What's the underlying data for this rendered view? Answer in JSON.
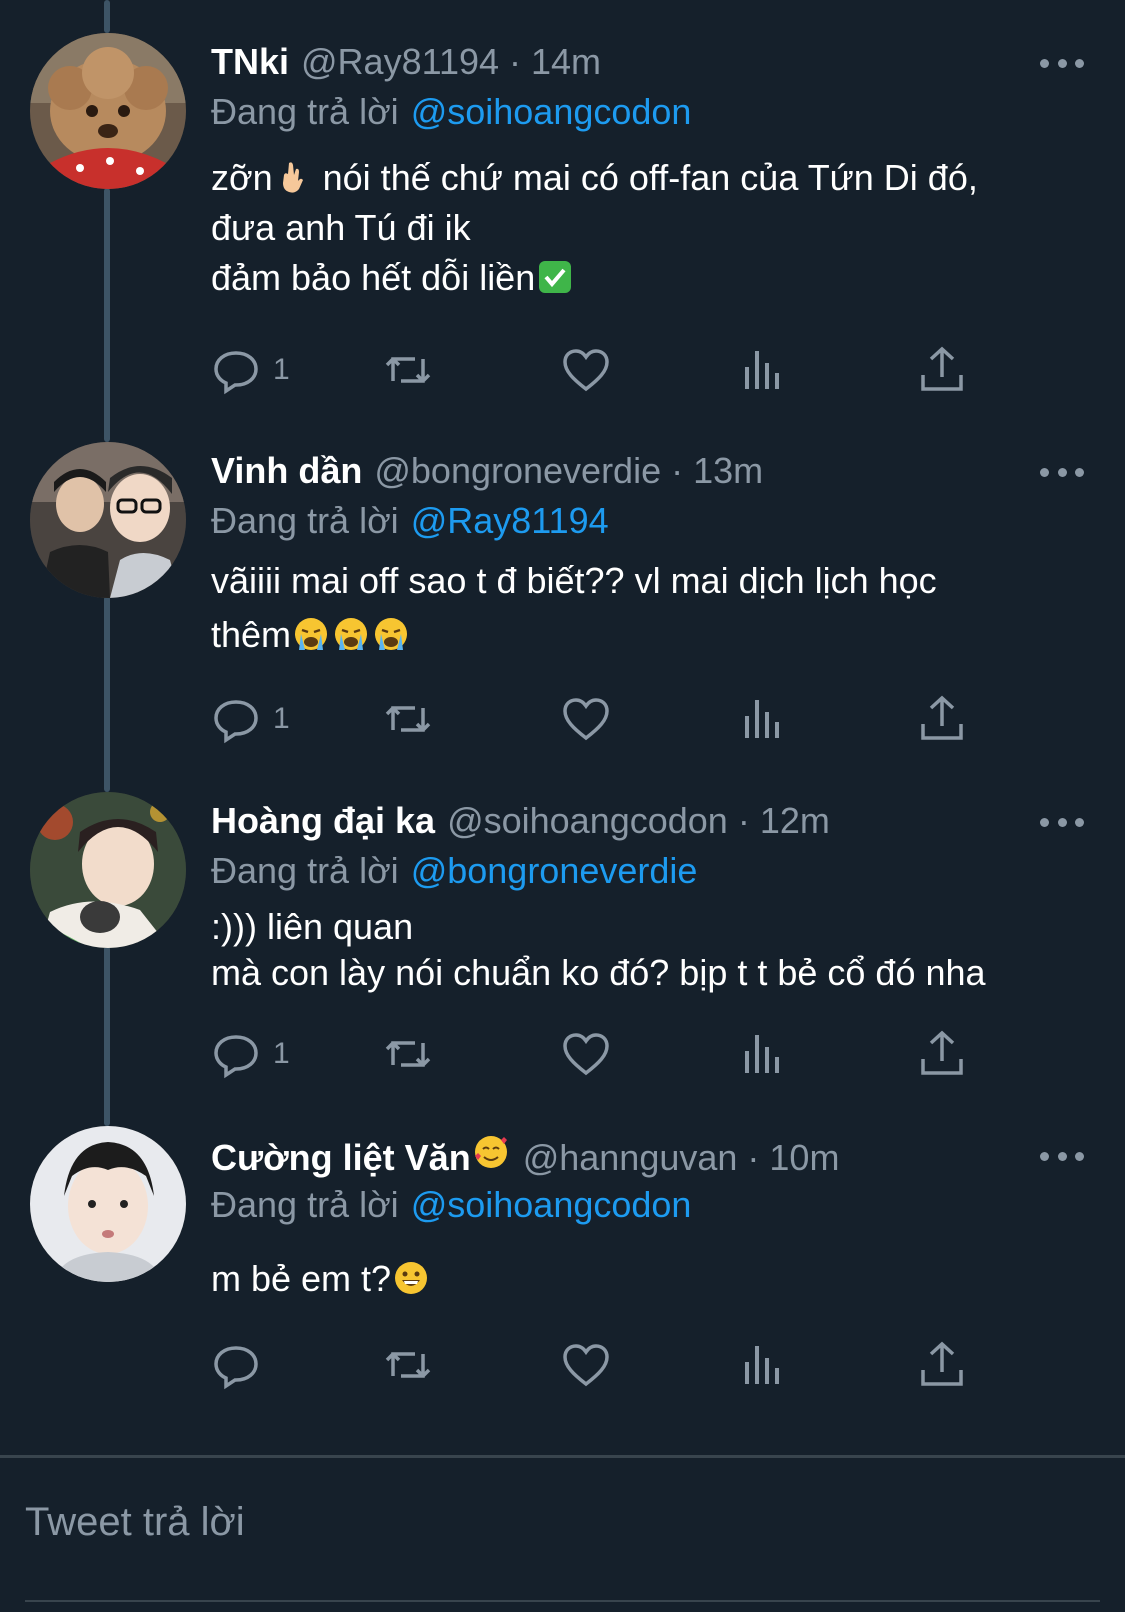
{
  "colors": {
    "background": "#15202b",
    "accent": "#1d9bf0",
    "muted": "#8b98a5",
    "thread_line": "#3d5466"
  },
  "tweets": [
    {
      "name": "TNki",
      "name_emoji": "",
      "handle": "@Ray81194",
      "time": "14m",
      "replying_prefix": "Đang trả lời",
      "replying_to": "@soihoangcodon",
      "lines": [
        {
          "text_a": "zỡn",
          "emoji": "hand-icon",
          "text_b": " nói thế chứ mai có off-fan của Tứn Di đó,"
        },
        {
          "text_a": "đưa anh Tú đi ik",
          "emoji": "",
          "text_b": ""
        },
        {
          "text_a": "đảm bảo hết dỗi liền",
          "emoji": "check-icon",
          "text_b": ""
        }
      ],
      "reply_count": "1",
      "avatar": "poodle-avatar"
    },
    {
      "name": "Vinh dần",
      "name_emoji": "",
      "handle": "@bongroneverdie",
      "time": "13m",
      "replying_prefix": "Đang trả lời",
      "replying_to": "@Ray81194",
      "lines": [
        {
          "text_a": "vãiiii mai off sao t đ biết?? vl mai dịch lịch học",
          "emoji": "",
          "text_b": ""
        },
        {
          "text_a": "thêm",
          "emoji": "crying-faces-icon",
          "text_b": ""
        }
      ],
      "reply_count": "1",
      "avatar": "two-people-avatar"
    },
    {
      "name": "Hoàng đại ka",
      "name_emoji": "",
      "handle": "@soihoangcodon",
      "time": "12m",
      "replying_prefix": "Đang trả lời",
      "replying_to": "@bongroneverdie",
      "lines": [
        {
          "text_a": ":))) liên quan",
          "emoji": "",
          "text_b": ""
        },
        {
          "text_a": "mà con lày nói chuẩn ko đó? bịp t t bẻ cổ đó nha",
          "emoji": "",
          "text_b": ""
        }
      ],
      "reply_count": "1",
      "avatar": "boy-avatar"
    },
    {
      "name": "Cường liệt Văn",
      "name_emoji": "smiling-hearts-icon",
      "handle": "@hannguvan",
      "time": "10m",
      "replying_prefix": "Đang trả lời",
      "replying_to": "@soihoangcodon",
      "lines": [
        {
          "text_a": "m bẻ em t?",
          "emoji": "grin-icon",
          "text_b": ""
        }
      ],
      "reply_count": "",
      "avatar": "man-avatar"
    }
  ],
  "reply_box": {
    "placeholder": "Tweet trả lời"
  },
  "icons": [
    "reply-icon",
    "retweet-icon",
    "like-icon",
    "analytics-icon",
    "share-icon",
    "more-icon"
  ]
}
